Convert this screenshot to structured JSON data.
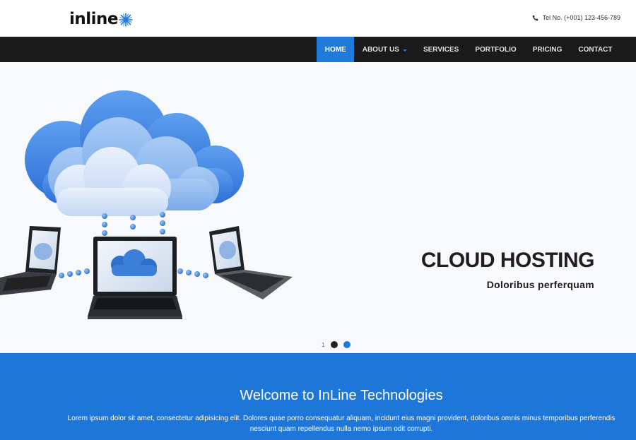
{
  "header": {
    "logo_text": "inline",
    "contact_text": "Tel No. (+001) 123-456-789"
  },
  "nav": {
    "items": [
      {
        "label": "HOME",
        "active": true
      },
      {
        "label": "ABOUT US",
        "has_dropdown": true
      },
      {
        "label": "SERVICES"
      },
      {
        "label": "PORTFOLIO"
      },
      {
        "label": "PRICING"
      },
      {
        "label": "CONTACT"
      }
    ]
  },
  "hero": {
    "title": "CLOUD HOSTING",
    "subtitle": "Doloribus perferquam",
    "pager_number": "1"
  },
  "welcome": {
    "title": "Welcome to InLine Technologies",
    "text": "Lorem ipsum dolor sit amet, consectetur adipisicing elit. Dolores quae porro consequatur aliquam, incidunt eius magni provident, doloribus omnis minus temporibus perferendis nesciunt quam repellendus nulla nemo ipsum odit corrupti."
  },
  "colors": {
    "accent": "#1e7bd9",
    "navbar": "#1b1a1b",
    "welcome_bg": "#1e76d8",
    "hero_text": "#231a22"
  },
  "icons": {
    "phone": "phone-icon",
    "logo_star": "star-burst-icon"
  }
}
